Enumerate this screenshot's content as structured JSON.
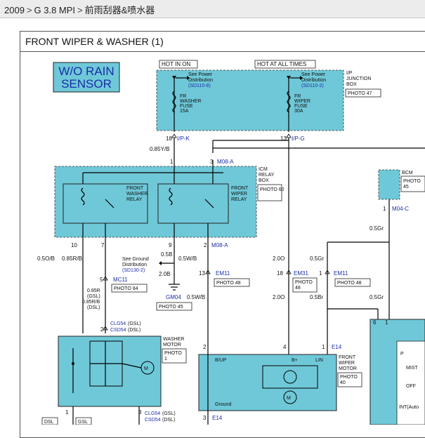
{
  "breadcrumb": {
    "year": "2009",
    "model": "G 3.8 MPI",
    "section": "前雨刮器&喷水器",
    "sep": ">"
  },
  "title": "FRONT WIPER & WASHER (1)",
  "rain_sensor": {
    "line1": "W/O RAIN",
    "line2": "SENSOR"
  },
  "hot_in_on": "HOT IN ON",
  "hot_at_all_times": "HOT AT ALL TIMES",
  "junction_box": {
    "label_lines": [
      "I/P",
      "JUNCTION",
      "BOX"
    ],
    "photo": "PHOTO 47",
    "see_power_1": [
      "See Power",
      "Distribution",
      "(SD110-8)"
    ],
    "see_power_2": [
      "See Power",
      "Distribution",
      "(SD110-2)"
    ],
    "fuse1": [
      "FR",
      "WASHER",
      "FUSE",
      "15A"
    ],
    "fuse2": [
      "FR",
      "WIPER",
      "FUSE",
      "30A"
    ]
  },
  "conn_ipk": {
    "pin": "18",
    "name": "I/P-K"
  },
  "conn_ipg": {
    "pin": "13",
    "name": "I/P-G"
  },
  "wire_085yb": "0.85Y/B",
  "icm": {
    "label_lines": [
      "ICM",
      "RELAY",
      "BOX"
    ],
    "photo": "PHOTO 60",
    "pin1": "1",
    "pin3": "3",
    "m08a_top": "M08-A",
    "washer_relay": [
      "FRONT",
      "WASHER",
      "RELAY"
    ],
    "wiper_relay": [
      "FRONT",
      "WIPER",
      "RELAY"
    ]
  },
  "bcm": {
    "label": "BCM",
    "photo_lines": [
      "PHOTO",
      "45"
    ],
    "pin": "1",
    "conn": "M04-C",
    "wire": "0.5Gr"
  },
  "icm_bottom": {
    "p10": "10",
    "p7": "7",
    "p9": "9",
    "p2": "2",
    "m08a": "M08-A"
  },
  "wires": {
    "w05ob": "0.5O/B",
    "w085rb": "0.85R/B",
    "w05b": "0.5B",
    "w05wb": "0.5W/B",
    "w20b": "2.0B",
    "w20o_a": "2.0O",
    "w05gr_a": "0.5Gr",
    "w05gr_b": "0.5Gr",
    "w05wb_b": "0.5W/B",
    "w20o_b": "2.0O",
    "w05br": "0.5Br",
    "w05gr_c": "0.5Gr"
  },
  "see_ground": [
    "See Ground",
    "Distribution",
    "(SD130-2)"
  ],
  "em11_a": {
    "pin": "13",
    "name": "EM11",
    "photo": "PHOTO 48"
  },
  "em31": {
    "pin": "18",
    "name": "EM31",
    "photo_lines": [
      "PHOTO",
      "48"
    ]
  },
  "em11_b": {
    "pin": "1",
    "name": "EM11",
    "photo": "PHOTO 48"
  },
  "mc11": {
    "pin": "5",
    "name": "MC11",
    "photo": "PHOTO 84"
  },
  "mc11_wires": [
    "0.85R",
    "(GSL)",
    "0.85R/B",
    "(DSL)"
  ],
  "gm04": {
    "name": "GM04",
    "photo": "PHOTO 45"
  },
  "clg54_top": {
    "pin": "2",
    "a": "CLG54",
    "a_suf": "(GSL)",
    "b": "CSD54",
    "b_suf": "(DSL)"
  },
  "washer_motor": {
    "label_lines": [
      "WASHER",
      "MOTOR"
    ],
    "photo_lines": [
      "PHOTO",
      "1"
    ]
  },
  "clg54_bot": {
    "pin1": "1",
    "pin3": "3",
    "a": "CLG54",
    "a_suf": "(GSL)",
    "b": "CSD54",
    "b_suf": "(DSL)"
  },
  "dsl": "DSL",
  "gsl": "GSL",
  "wiper_motor": {
    "label_lines": [
      "FRONT",
      "WIPER",
      "MOTOR"
    ],
    "photo_lines": [
      "PHOTO",
      "40"
    ],
    "pin2": "2",
    "pin4": "4",
    "pin1": "1",
    "conn": "E14",
    "bup": "B/UP",
    "bplus": "B+",
    "lin": "LIN",
    "ground": "Ground",
    "pin3": "3",
    "conn_bot": "E14"
  },
  "switch": {
    "pins": [
      "6",
      "1"
    ],
    "p": "P",
    "mist": "MIST",
    "off": "OFF",
    "int": "INT(Auto"
  }
}
